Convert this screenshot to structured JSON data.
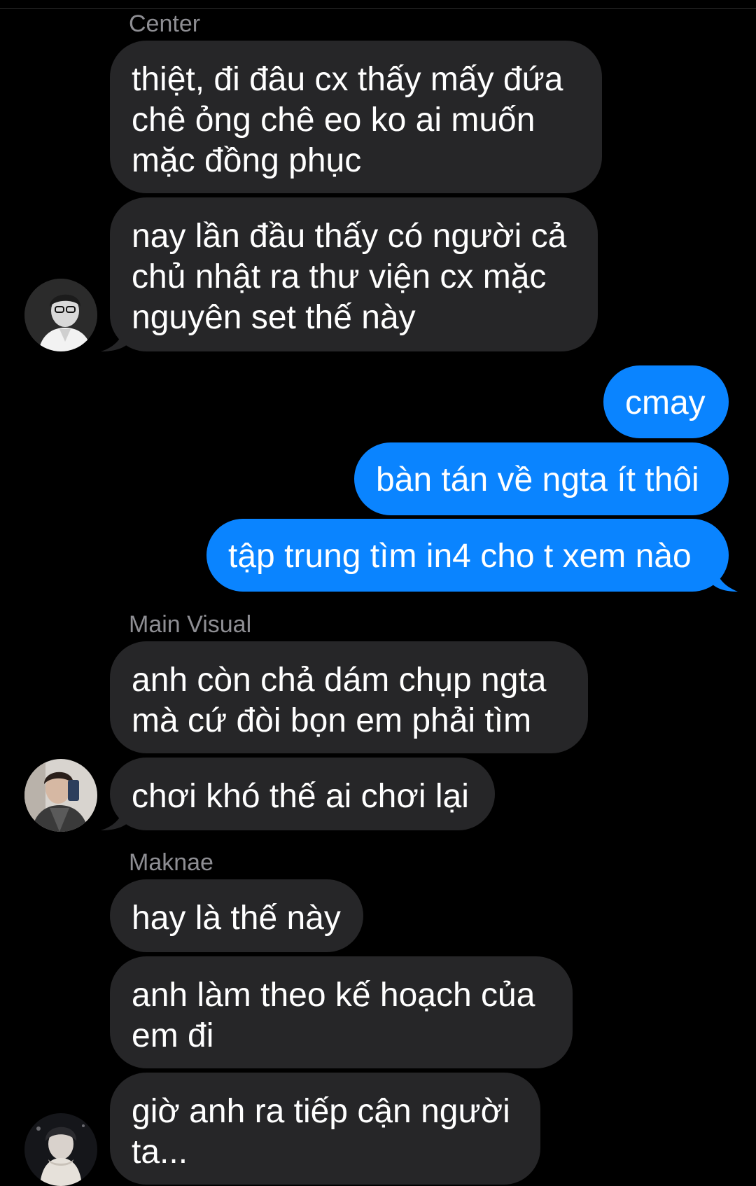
{
  "colors": {
    "background": "#000000",
    "incoming_bubble": "#262628",
    "outgoing_bubble": "#0a84ff",
    "sender_name": "#8e8e93",
    "text": "#ffffff"
  },
  "conversation": {
    "groups": [
      {
        "sender": "Center",
        "avatar_icon": "avatar-icon",
        "messages": [
          {
            "lines": [
              "thiệt, đi đâu cx thấy mấy đứa",
              "chê ỏng chê eo ko ai muốn",
              "mặc đồng phục"
            ]
          },
          {
            "lines": [
              "nay lần đầu thấy có người cả",
              "chủ nhật ra thư viện cx mặc",
              "nguyên set thế này"
            ]
          }
        ]
      },
      {
        "sender": "",
        "outgoing": true,
        "messages": [
          {
            "lines": [
              "cmay"
            ]
          },
          {
            "lines": [
              "bàn tán về ngta ít thôi"
            ]
          },
          {
            "lines": [
              "tập trung tìm in4 cho t xem nào"
            ]
          }
        ]
      },
      {
        "sender": "Main Visual",
        "avatar_icon": "avatar-icon",
        "messages": [
          {
            "lines": [
              "anh còn chả dám chụp ngta",
              "mà cứ đòi bọn em phải tìm"
            ]
          },
          {
            "lines": [
              "chơi khó thế ai chơi lại"
            ]
          }
        ]
      },
      {
        "sender": "Maknae",
        "avatar_icon": "avatar-icon",
        "messages": [
          {
            "lines": [
              "hay là thế này"
            ]
          },
          {
            "lines": [
              "anh làm theo kế hoạch của",
              "em đi"
            ]
          },
          {
            "lines": [
              "giờ anh ra tiếp cận người",
              "ta..."
            ]
          }
        ]
      }
    ]
  }
}
